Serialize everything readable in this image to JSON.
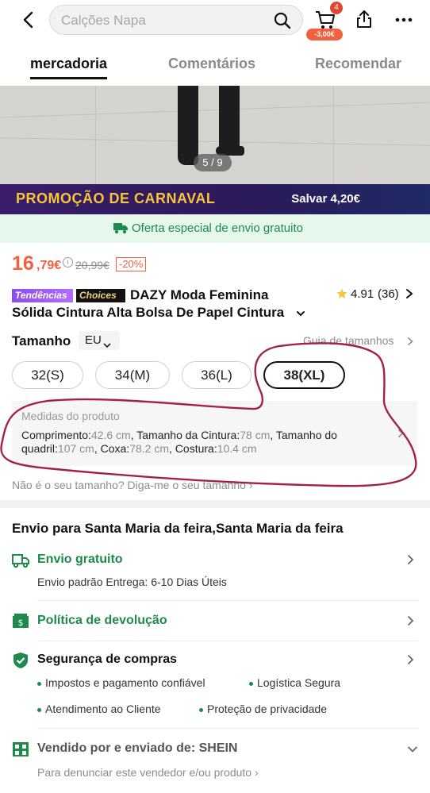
{
  "header": {
    "search_placeholder": "Calções Napa",
    "cart_count": "4",
    "cart_discount": "-3,00€"
  },
  "tabs": [
    {
      "label": "mercadoria",
      "active": true
    },
    {
      "label": "Comentários",
      "active": false
    },
    {
      "label": "Recomendar",
      "active": false
    }
  ],
  "gallery": {
    "pager": "5 / 9"
  },
  "promo": {
    "title": "PROMOÇÃO DE CARNAVAL",
    "save": "Salvar 4,20€"
  },
  "shipping_banner": {
    "text": "Oferta especial de envio gratuito"
  },
  "price": {
    "integer": "16",
    "cents": ",79€",
    "info_icon": "i",
    "original": "20,99€",
    "discount": "-20%"
  },
  "product": {
    "badge_trend": "Tendências",
    "badge_choices": "Choices",
    "title_line1": "DAZY Moda Feminina",
    "title_line2": "Sólida Cintura Alta Bolsa De Papel Cintura",
    "rating": "4.91",
    "rating_count": "(36)"
  },
  "size": {
    "label": "Tamanho",
    "unit": "EU",
    "guide": "Guia de tamanhos",
    "options": [
      "32(S)",
      "34(M)",
      "36(L)",
      "38(XL)"
    ],
    "selected": "38(XL)",
    "help": "Não é o seu tamanho? Diga-me o seu tamanho"
  },
  "measurements": {
    "title": "Medidas do produto",
    "items": [
      {
        "label": "Comprimento:",
        "value": "42.6 cm"
      },
      {
        "label": "Tamanho da Cintura:",
        "value": "78 cm"
      },
      {
        "label": "Tamanho do quadril:",
        "value": "107 cm"
      },
      {
        "label": "Coxa:",
        "value": "78.2 cm"
      },
      {
        "label": "Costura:",
        "value": "10.4 cm"
      }
    ]
  },
  "shipping": {
    "heading": "Envio para Santa Maria da feira,Santa Maria da feira",
    "free_title": "Envio gratuito",
    "free_sub": "Envio padrão Entrega: 6-10 Dias Úteis",
    "return_title": "Política de devolução",
    "security_title": "Segurança de compras",
    "security_points": [
      "Impostos e pagamento confiável",
      "Logística Segura",
      "Atendimento ao Cliente",
      "Proteção de privacidade"
    ],
    "seller_title": "Vendido por e enviado de: SHEIN",
    "seller_sub": "Para denunciar este vendedor e/ou produto"
  },
  "colors": {
    "accent_orange": "#f3603f",
    "green": "#1e8a4c",
    "annotation_red": "#a31f4f"
  }
}
